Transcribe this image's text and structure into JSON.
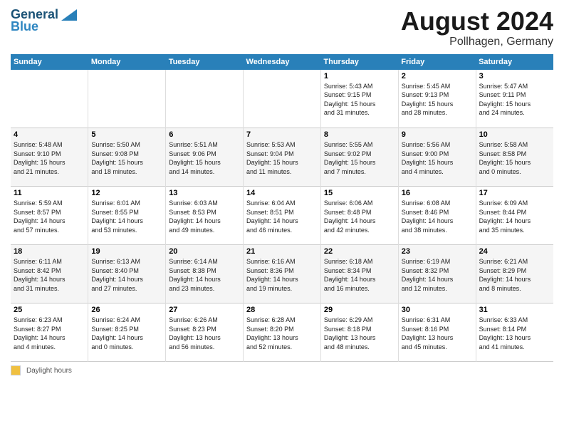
{
  "logo": {
    "line1": "General",
    "line2": "Blue"
  },
  "title": "August 2024",
  "location": "Pollhagen, Germany",
  "days_of_week": [
    "Sunday",
    "Monday",
    "Tuesday",
    "Wednesday",
    "Thursday",
    "Friday",
    "Saturday"
  ],
  "weeks": [
    [
      {
        "num": "",
        "info": ""
      },
      {
        "num": "",
        "info": ""
      },
      {
        "num": "",
        "info": ""
      },
      {
        "num": "",
        "info": ""
      },
      {
        "num": "1",
        "info": "Sunrise: 5:43 AM\nSunset: 9:15 PM\nDaylight: 15 hours\nand 31 minutes."
      },
      {
        "num": "2",
        "info": "Sunrise: 5:45 AM\nSunset: 9:13 PM\nDaylight: 15 hours\nand 28 minutes."
      },
      {
        "num": "3",
        "info": "Sunrise: 5:47 AM\nSunset: 9:11 PM\nDaylight: 15 hours\nand 24 minutes."
      }
    ],
    [
      {
        "num": "4",
        "info": "Sunrise: 5:48 AM\nSunset: 9:10 PM\nDaylight: 15 hours\nand 21 minutes."
      },
      {
        "num": "5",
        "info": "Sunrise: 5:50 AM\nSunset: 9:08 PM\nDaylight: 15 hours\nand 18 minutes."
      },
      {
        "num": "6",
        "info": "Sunrise: 5:51 AM\nSunset: 9:06 PM\nDaylight: 15 hours\nand 14 minutes."
      },
      {
        "num": "7",
        "info": "Sunrise: 5:53 AM\nSunset: 9:04 PM\nDaylight: 15 hours\nand 11 minutes."
      },
      {
        "num": "8",
        "info": "Sunrise: 5:55 AM\nSunset: 9:02 PM\nDaylight: 15 hours\nand 7 minutes."
      },
      {
        "num": "9",
        "info": "Sunrise: 5:56 AM\nSunset: 9:00 PM\nDaylight: 15 hours\nand 4 minutes."
      },
      {
        "num": "10",
        "info": "Sunrise: 5:58 AM\nSunset: 8:58 PM\nDaylight: 15 hours\nand 0 minutes."
      }
    ],
    [
      {
        "num": "11",
        "info": "Sunrise: 5:59 AM\nSunset: 8:57 PM\nDaylight: 14 hours\nand 57 minutes."
      },
      {
        "num": "12",
        "info": "Sunrise: 6:01 AM\nSunset: 8:55 PM\nDaylight: 14 hours\nand 53 minutes."
      },
      {
        "num": "13",
        "info": "Sunrise: 6:03 AM\nSunset: 8:53 PM\nDaylight: 14 hours\nand 49 minutes."
      },
      {
        "num": "14",
        "info": "Sunrise: 6:04 AM\nSunset: 8:51 PM\nDaylight: 14 hours\nand 46 minutes."
      },
      {
        "num": "15",
        "info": "Sunrise: 6:06 AM\nSunset: 8:48 PM\nDaylight: 14 hours\nand 42 minutes."
      },
      {
        "num": "16",
        "info": "Sunrise: 6:08 AM\nSunset: 8:46 PM\nDaylight: 14 hours\nand 38 minutes."
      },
      {
        "num": "17",
        "info": "Sunrise: 6:09 AM\nSunset: 8:44 PM\nDaylight: 14 hours\nand 35 minutes."
      }
    ],
    [
      {
        "num": "18",
        "info": "Sunrise: 6:11 AM\nSunset: 8:42 PM\nDaylight: 14 hours\nand 31 minutes."
      },
      {
        "num": "19",
        "info": "Sunrise: 6:13 AM\nSunset: 8:40 PM\nDaylight: 14 hours\nand 27 minutes."
      },
      {
        "num": "20",
        "info": "Sunrise: 6:14 AM\nSunset: 8:38 PM\nDaylight: 14 hours\nand 23 minutes."
      },
      {
        "num": "21",
        "info": "Sunrise: 6:16 AM\nSunset: 8:36 PM\nDaylight: 14 hours\nand 19 minutes."
      },
      {
        "num": "22",
        "info": "Sunrise: 6:18 AM\nSunset: 8:34 PM\nDaylight: 14 hours\nand 16 minutes."
      },
      {
        "num": "23",
        "info": "Sunrise: 6:19 AM\nSunset: 8:32 PM\nDaylight: 14 hours\nand 12 minutes."
      },
      {
        "num": "24",
        "info": "Sunrise: 6:21 AM\nSunset: 8:29 PM\nDaylight: 14 hours\nand 8 minutes."
      }
    ],
    [
      {
        "num": "25",
        "info": "Sunrise: 6:23 AM\nSunset: 8:27 PM\nDaylight: 14 hours\nand 4 minutes."
      },
      {
        "num": "26",
        "info": "Sunrise: 6:24 AM\nSunset: 8:25 PM\nDaylight: 14 hours\nand 0 minutes."
      },
      {
        "num": "27",
        "info": "Sunrise: 6:26 AM\nSunset: 8:23 PM\nDaylight: 13 hours\nand 56 minutes."
      },
      {
        "num": "28",
        "info": "Sunrise: 6:28 AM\nSunset: 8:20 PM\nDaylight: 13 hours\nand 52 minutes."
      },
      {
        "num": "29",
        "info": "Sunrise: 6:29 AM\nSunset: 8:18 PM\nDaylight: 13 hours\nand 48 minutes."
      },
      {
        "num": "30",
        "info": "Sunrise: 6:31 AM\nSunset: 8:16 PM\nDaylight: 13 hours\nand 45 minutes."
      },
      {
        "num": "31",
        "info": "Sunrise: 6:33 AM\nSunset: 8:14 PM\nDaylight: 13 hours\nand 41 minutes."
      }
    ]
  ],
  "footer": {
    "legend_label": "Daylight hours"
  }
}
